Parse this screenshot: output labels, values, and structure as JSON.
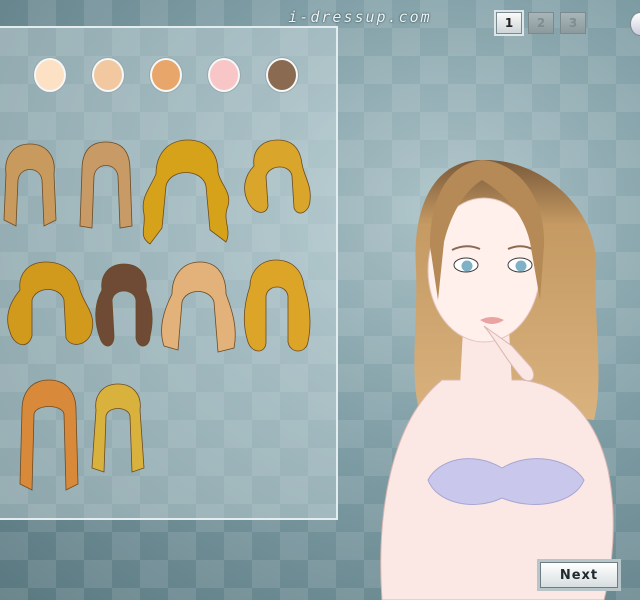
{
  "site": {
    "title": "i-dressup.com"
  },
  "pager": {
    "pages": [
      {
        "label": "1",
        "active": true
      },
      {
        "label": "2",
        "active": false
      },
      {
        "label": "3",
        "active": false
      }
    ]
  },
  "skin_tones": [
    "#fde1c4",
    "#f1c89f",
    "#e9a66a",
    "#f8c6c6",
    "#8b6a52"
  ],
  "hair_styles": [
    {
      "name": "shoulder-length light brown",
      "color": "#c99a5e"
    },
    {
      "name": "straight long light brown",
      "color": "#c79a66"
    },
    {
      "name": "long wavy golden",
      "color": "#d6a21a"
    },
    {
      "name": "curly golden",
      "color": "#d9a52a"
    },
    {
      "name": "wavy golden dark roots",
      "color": "#d19a1c"
    },
    {
      "name": "curly dark brown",
      "color": "#6f4a35"
    },
    {
      "name": "long wavy sandy",
      "color": "#e2b27a"
    },
    {
      "name": "crimped golden",
      "color": "#dca528"
    },
    {
      "name": "straight copper with bangs",
      "color": "#d8893a"
    },
    {
      "name": "straight blonde",
      "color": "#d8b23c"
    }
  ],
  "controls": {
    "next_label": "Next"
  }
}
